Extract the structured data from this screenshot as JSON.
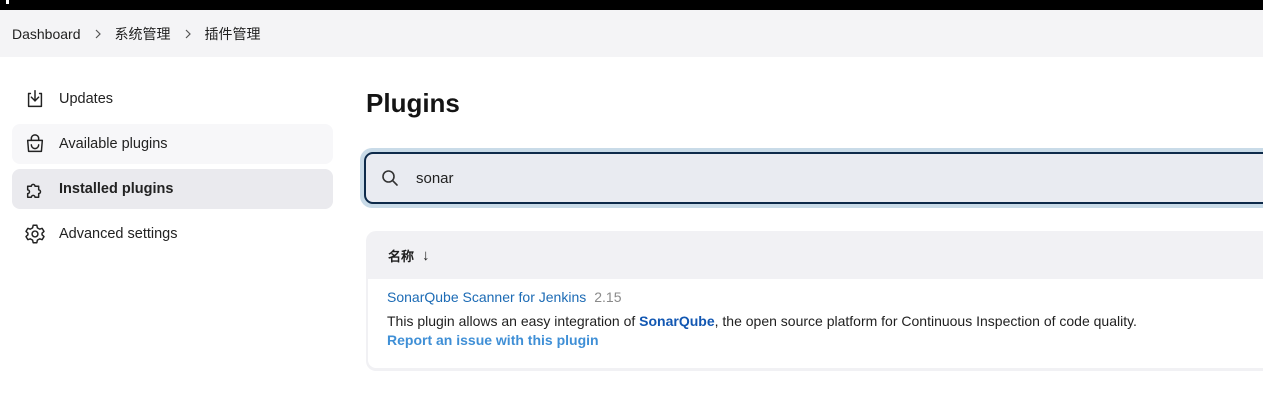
{
  "breadcrumb": {
    "items": [
      "Dashboard",
      "系统管理",
      "插件管理"
    ]
  },
  "sidebar": {
    "items": [
      {
        "label": "Updates",
        "icon": "download-icon"
      },
      {
        "label": "Available plugins",
        "icon": "shopping-bag-icon"
      },
      {
        "label": "Installed plugins",
        "icon": "puzzle-icon"
      },
      {
        "label": "Advanced settings",
        "icon": "gear-icon"
      }
    ]
  },
  "main": {
    "title": "Plugins",
    "search": {
      "value": "sonar",
      "placeholder": ""
    },
    "table": {
      "column_header": "名称",
      "sort_indicator": "↓",
      "rows": [
        {
          "name": "SonarQube Scanner for Jenkins",
          "version": "2.15",
          "description_prefix": "This plugin allows an easy integration of ",
          "description_link": "SonarQube",
          "description_suffix": ", the open source platform for Continuous Inspection of code quality.",
          "report_link": "Report an issue with this plugin"
        }
      ]
    }
  },
  "colors": {
    "link": "#1c6bb5",
    "active_item_bg": "#eaeaee",
    "search_border": "#0d2a4a",
    "search_focus_ring": "#c9dbe8"
  }
}
